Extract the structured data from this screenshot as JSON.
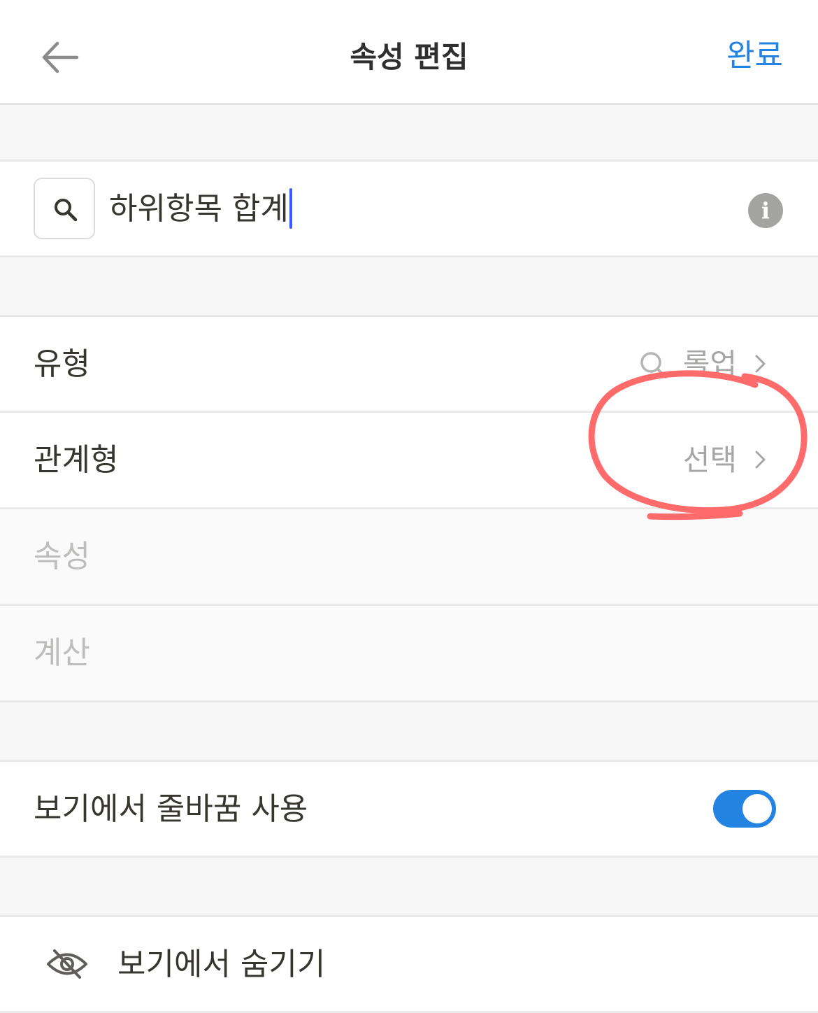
{
  "header": {
    "title": "속성 편집",
    "done_label": "완료"
  },
  "property": {
    "name_value": "하위항목 합계"
  },
  "settings": {
    "type_label": "유형",
    "type_value": "롤업",
    "relation_label": "관계형",
    "relation_value": "선택",
    "property_label": "속성",
    "calculate_label": "계산"
  },
  "view_options": {
    "wrap_label": "보기에서 줄바꿈 사용",
    "wrap_enabled": true,
    "hide_label": "보기에서 숨기기"
  },
  "colors": {
    "accent": "#2383e2",
    "annotation": "#ff6b6b",
    "caret": "#3d5afe"
  }
}
